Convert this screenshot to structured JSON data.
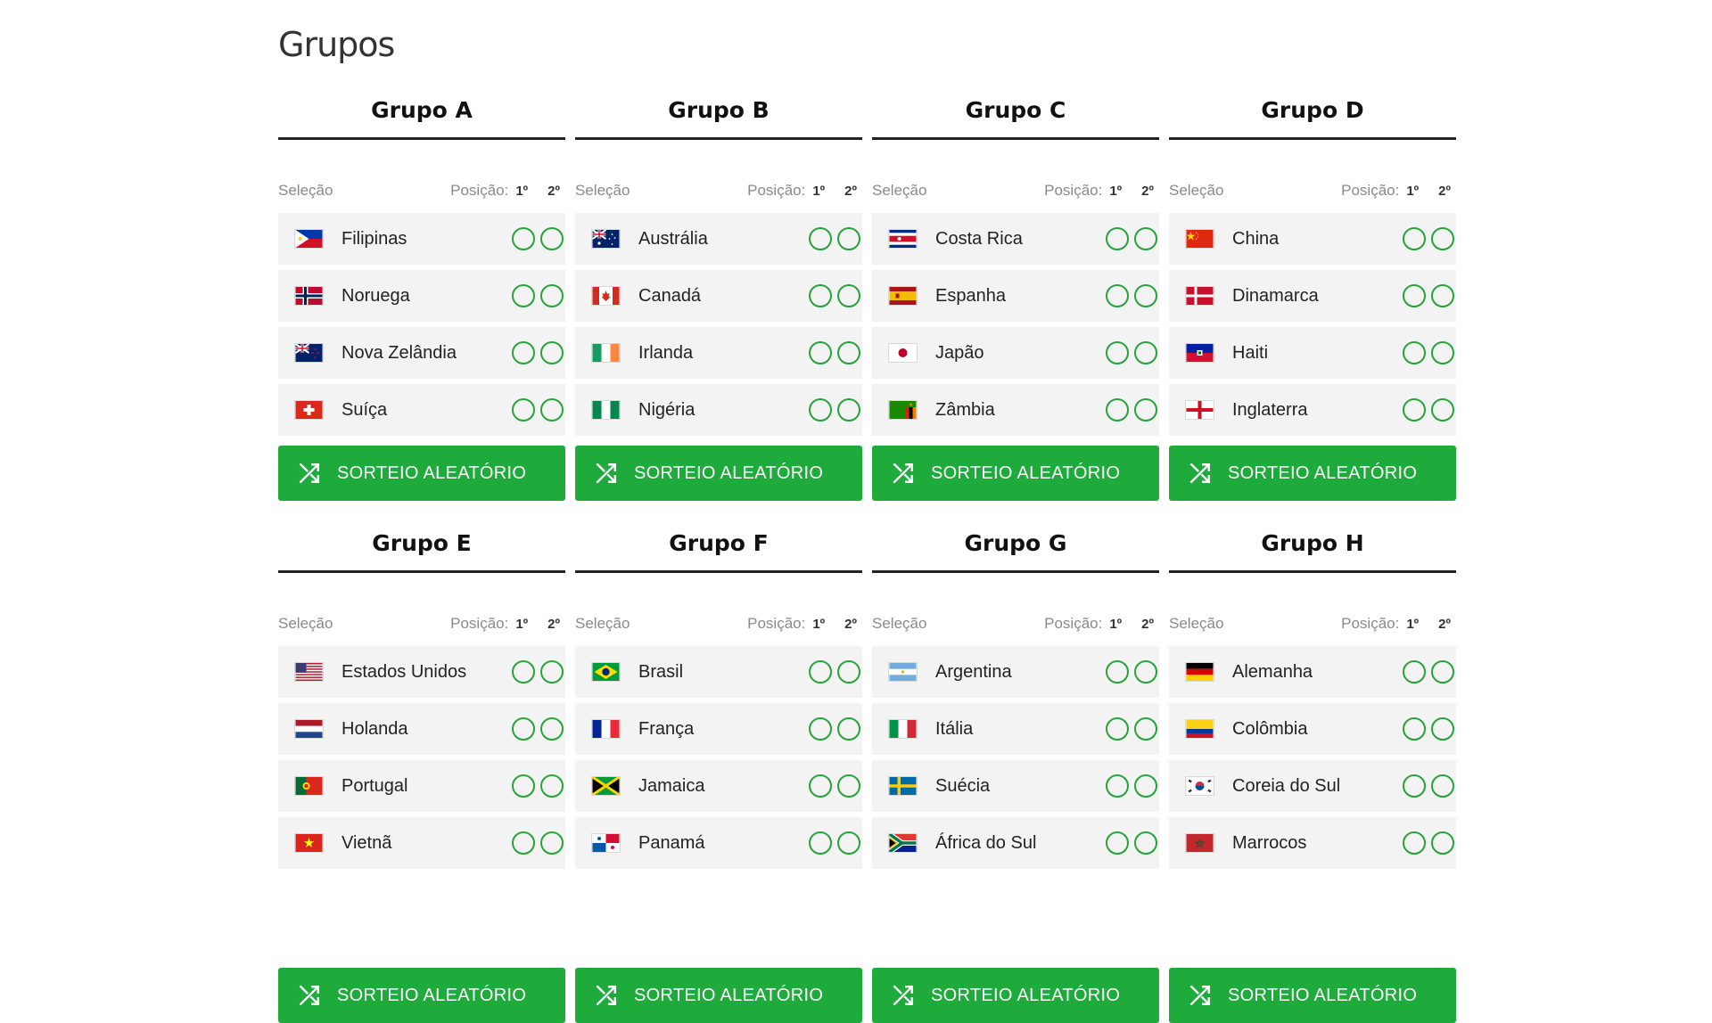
{
  "page": {
    "title": "Grupos"
  },
  "labels": {
    "selection": "Seleção",
    "position": "Posição:",
    "first": "1º",
    "second": "2º",
    "shuffle_button": "SORTEIO ALEATÓRIO"
  },
  "colors": {
    "accent_green": "#1faa3c",
    "radio_border": "#27a33a",
    "row_bg": "#f3f3f3"
  },
  "groups": [
    {
      "title": "Grupo A",
      "teams": [
        {
          "name": "Filipinas",
          "flag": "philippines-flag"
        },
        {
          "name": "Noruega",
          "flag": "norway-flag"
        },
        {
          "name": "Nova Zelândia",
          "flag": "new-zealand-flag"
        },
        {
          "name": "Suíça",
          "flag": "switzerland-flag"
        }
      ]
    },
    {
      "title": "Grupo B",
      "teams": [
        {
          "name": "Austrália",
          "flag": "australia-flag"
        },
        {
          "name": "Canadá",
          "flag": "canada-flag"
        },
        {
          "name": "Irlanda",
          "flag": "ireland-flag"
        },
        {
          "name": "Nigéria",
          "flag": "nigeria-flag"
        }
      ]
    },
    {
      "title": "Grupo C",
      "teams": [
        {
          "name": "Costa Rica",
          "flag": "costa-rica-flag"
        },
        {
          "name": "Espanha",
          "flag": "spain-flag"
        },
        {
          "name": "Japão",
          "flag": "japan-flag"
        },
        {
          "name": "Zâmbia",
          "flag": "zambia-flag"
        }
      ]
    },
    {
      "title": "Grupo D",
      "teams": [
        {
          "name": "China",
          "flag": "china-flag"
        },
        {
          "name": "Dinamarca",
          "flag": "denmark-flag"
        },
        {
          "name": "Haiti",
          "flag": "haiti-flag"
        },
        {
          "name": "Inglaterra",
          "flag": "england-flag"
        }
      ]
    },
    {
      "title": "Grupo E",
      "teams": [
        {
          "name": "Estados Unidos",
          "flag": "usa-flag"
        },
        {
          "name": "Holanda",
          "flag": "netherlands-flag"
        },
        {
          "name": "Portugal",
          "flag": "portugal-flag"
        },
        {
          "name": "Vietnã",
          "flag": "vietnam-flag"
        }
      ]
    },
    {
      "title": "Grupo F",
      "teams": [
        {
          "name": "Brasil",
          "flag": "brazil-flag"
        },
        {
          "name": "França",
          "flag": "france-flag"
        },
        {
          "name": "Jamaica",
          "flag": "jamaica-flag"
        },
        {
          "name": "Panamá",
          "flag": "panama-flag"
        }
      ]
    },
    {
      "title": "Grupo G",
      "teams": [
        {
          "name": "Argentina",
          "flag": "argentina-flag"
        },
        {
          "name": "Itália",
          "flag": "italy-flag"
        },
        {
          "name": "Suécia",
          "flag": "sweden-flag"
        },
        {
          "name": "África do Sul",
          "flag": "south-africa-flag"
        }
      ]
    },
    {
      "title": "Grupo H",
      "teams": [
        {
          "name": "Alemanha",
          "flag": "germany-flag"
        },
        {
          "name": "Colômbia",
          "flag": "colombia-flag"
        },
        {
          "name": "Coreia do Sul",
          "flag": "south-korea-flag"
        },
        {
          "name": "Marrocos",
          "flag": "morocco-flag"
        }
      ]
    }
  ]
}
